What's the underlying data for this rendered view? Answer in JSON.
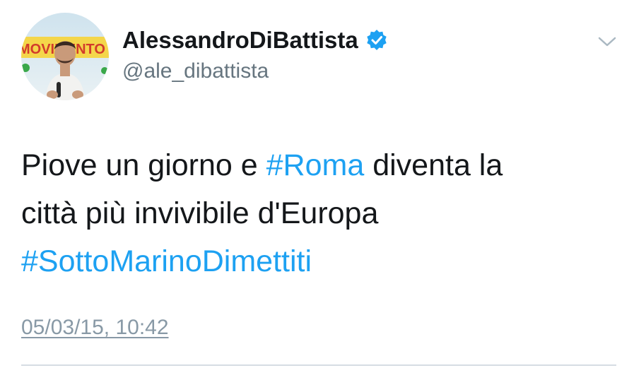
{
  "author": {
    "display_name": "AlessandroDiBattista",
    "handle": "@ale_dibattista",
    "verified": true,
    "avatar_banner_text": "MOVIMENTO"
  },
  "tweet": {
    "line1_prefix": "Piove un giorno e ",
    "line1_hashtag": "#Roma",
    "line1_suffix": " diventa la",
    "line2": "città più invivibile d'Europa",
    "line3_hashtag": "#SottoMarinoDimettiti"
  },
  "timestamp": "05/03/15, 10:42",
  "icons": {
    "verified": "verified-badge-icon",
    "menu": "chevron-down-icon"
  },
  "colors": {
    "hashtag": "#1da1f2",
    "verified": "#1da1f2",
    "name": "#14171a",
    "secondary": "#66757f"
  }
}
